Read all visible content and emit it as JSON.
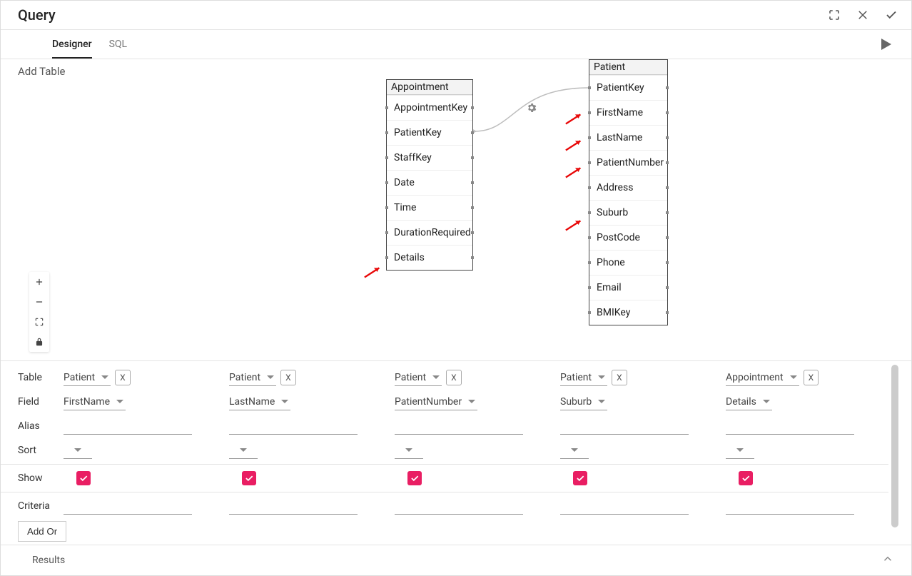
{
  "header": {
    "title": "Query"
  },
  "tabs": {
    "designer": "Designer",
    "sql": "SQL",
    "active": "designer"
  },
  "canvas": {
    "add_table_label": "Add Table",
    "tables": {
      "appointment": {
        "title": "Appointment",
        "columns": [
          "AppointmentKey",
          "PatientKey",
          "StaffKey",
          "Date",
          "Time",
          "DurationRequired",
          "Details"
        ]
      },
      "patient": {
        "title": "Patient",
        "columns": [
          "PatientKey",
          "FirstName",
          "LastName",
          "PatientNumber",
          "Address",
          "Suburb",
          "PostCode",
          "Phone",
          "Email",
          "BMIKey"
        ]
      }
    },
    "join": {
      "from": {
        "table": "Appointment",
        "column": "PatientKey"
      },
      "to": {
        "table": "Patient",
        "column": "PatientKey"
      }
    }
  },
  "icons": {
    "expand": "expand-icon",
    "close": "close-icon",
    "confirm": "check-icon",
    "run": "play-icon",
    "zoom_in": "plus-icon",
    "zoom_out": "minus-icon",
    "fit": "fullscreen-icon",
    "lock": "lock-icon",
    "gear": "gear-icon",
    "chevron_up": "chevron-up-icon"
  },
  "grid": {
    "row_labels": {
      "table": "Table",
      "field": "Field",
      "alias": "Alias",
      "sort": "Sort",
      "show": "Show",
      "criteria": "Criteria"
    },
    "add_or_label": "Add Or",
    "x_button_label": "X",
    "columns": [
      {
        "table": "Patient",
        "field": "FirstName",
        "alias": "",
        "sort": "",
        "show": true,
        "criteria": ""
      },
      {
        "table": "Patient",
        "field": "LastName",
        "alias": "",
        "sort": "",
        "show": true,
        "criteria": ""
      },
      {
        "table": "Patient",
        "field": "PatientNumber",
        "alias": "",
        "sort": "",
        "show": true,
        "criteria": ""
      },
      {
        "table": "Patient",
        "field": "Suburb",
        "alias": "",
        "sort": "",
        "show": true,
        "criteria": ""
      },
      {
        "table": "Appointment",
        "field": "Details",
        "alias": "",
        "sort": "",
        "show": true,
        "criteria": ""
      }
    ]
  },
  "results": {
    "label": "Results"
  }
}
